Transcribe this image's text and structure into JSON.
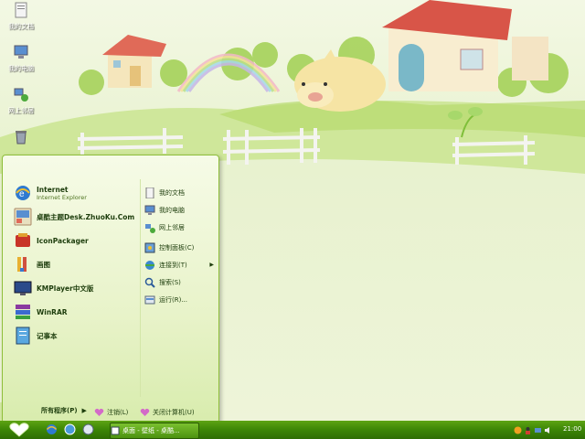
{
  "desktop": {
    "icons": [
      {
        "label": "我的文档",
        "icon": "my-documents-icon"
      },
      {
        "label": "我的电脑",
        "icon": "my-computer-icon"
      },
      {
        "label": "网上邻居",
        "icon": "network-places-icon"
      },
      {
        "label": "",
        "icon": "recycle-bin-icon"
      }
    ]
  },
  "start_menu": {
    "programs": [
      {
        "name": "Internet",
        "sub": "Internet Explorer",
        "icon": "internet-explorer-icon"
      },
      {
        "name": "桌酷主题Desk.ZhuoKu.Com",
        "sub": "",
        "icon": "zhuoku-icon"
      },
      {
        "name": "IconPackager",
        "sub": "",
        "icon": "iconpackager-icon"
      },
      {
        "name": "画图",
        "sub": "",
        "icon": "paint-icon"
      },
      {
        "name": "KMPlayer中文版",
        "sub": "",
        "icon": "kmplayer-icon"
      },
      {
        "name": "WinRAR",
        "sub": "",
        "icon": "winrar-icon"
      },
      {
        "name": "记事本",
        "sub": "",
        "icon": "notepad-icon"
      }
    ],
    "all_programs": "所有程序(P)",
    "places": [
      {
        "name": "我的文档",
        "icon": "my-documents-icon"
      },
      {
        "name": "我的电脑",
        "icon": "my-computer-icon"
      },
      {
        "name": "网上邻居",
        "icon": "network-places-icon"
      },
      {
        "name": "控制面板(C)",
        "icon": "control-panel-icon"
      },
      {
        "name": "连接到(T)",
        "icon": "connect-to-icon"
      },
      {
        "name": "搜索(S)",
        "icon": "search-icon"
      },
      {
        "name": "运行(R)...",
        "icon": "run-icon"
      }
    ],
    "footer": {
      "logoff": "注销(L)",
      "shutdown": "关闭计算机(U)"
    }
  },
  "taskbar": {
    "task_item": "桌面 - 壁纸 - 桌酷...",
    "clock": "21:00"
  },
  "colors": {
    "taskbar": "#3c8506",
    "menu_bg": "#eef6d6",
    "accent": "#8fbf3a"
  }
}
